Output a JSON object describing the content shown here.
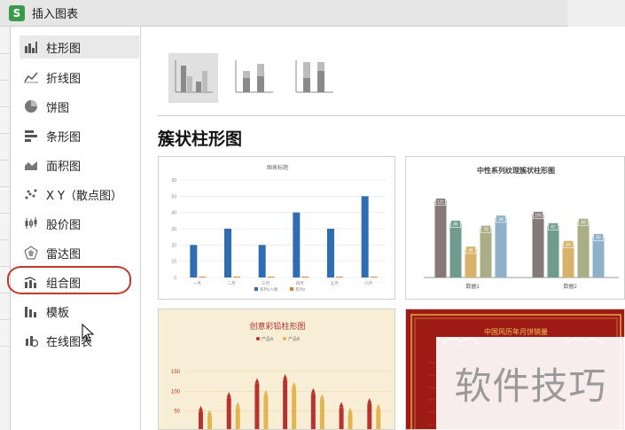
{
  "window": {
    "title": "插入图表",
    "logo_letter": "S"
  },
  "sidebar": {
    "items": [
      {
        "label": "柱形图",
        "icon": "column-chart-icon",
        "active": true
      },
      {
        "label": "折线图",
        "icon": "line-chart-icon"
      },
      {
        "label": "饼图",
        "icon": "pie-chart-icon"
      },
      {
        "label": "条形图",
        "icon": "bar-chart-icon"
      },
      {
        "label": "面积图",
        "icon": "area-chart-icon"
      },
      {
        "label": "X Y（散点图）",
        "icon": "scatter-chart-icon"
      },
      {
        "label": "股价图",
        "icon": "stock-chart-icon"
      },
      {
        "label": "雷达图",
        "icon": "radar-chart-icon"
      },
      {
        "label": "组合图",
        "icon": "combo-chart-icon"
      },
      {
        "label": "模板",
        "icon": "template-icon"
      },
      {
        "label": "在线图表",
        "icon": "online-chart-icon"
      }
    ]
  },
  "main": {
    "section_title": "簇状柱形图",
    "subtypes": [
      "clustered-column-icon",
      "stacked-column-icon",
      "percent-stacked-column-icon"
    ],
    "cards": [
      {
        "title": "图表标题",
        "chart_data": {
          "type": "bar",
          "title": "图表标题",
          "categories": [
            "一月",
            "二月",
            "三月",
            "四月",
            "五月",
            "六月"
          ],
          "series": [
            {
              "name": "系列1人数",
              "values": [
                20,
                30,
                20,
                40,
                30,
                50
              ],
              "color": "#2e6db3"
            },
            {
              "name": "系列2",
              "values": [
                0.5,
                0.5,
                0.5,
                0.5,
                0.5,
                0.5
              ],
              "color": "#e07b2a"
            }
          ],
          "ylim": [
            0,
            60
          ],
          "yticks": [
            0,
            10,
            20,
            30,
            40,
            50,
            60
          ]
        }
      },
      {
        "title": "中性系列纹理簇状柱形图",
        "chart_data": {
          "type": "bar",
          "title": "中性系列纹理簇状柱形图",
          "categories": [
            "数据1",
            "数据2"
          ],
          "series": [
            {
              "values": [
                121,
                100
              ],
              "color": "#857a78"
            },
            {
              "values": [
                86,
                82
              ],
              "color": "#6f9c8e"
            },
            {
              "values": [
                45,
                54
              ],
              "color": "#d8b26a"
            },
            {
              "values": [
                78,
                89
              ],
              "color": "#a9ae86"
            },
            {
              "values": [
                94,
                65
              ],
              "color": "#8eb0c8"
            }
          ],
          "ylim": [
            0,
            140
          ]
        }
      },
      {
        "title": "创意彩铅柱形图",
        "legend": [
          "产品A",
          "产品B"
        ],
        "chart_data": {
          "type": "bar",
          "title": "创意彩铅柱形图",
          "yticks": [
            0,
            50,
            100,
            150
          ],
          "ylim": [
            0,
            150
          ],
          "series": [
            {
              "name": "产品A",
              "values": [
                50,
                85,
                120,
                130,
                95,
                60,
                70
              ],
              "color": "#b8322e"
            },
            {
              "name": "产品B",
              "values": [
                40,
                60,
                90,
                110,
                80,
                45,
                55
              ],
              "color": "#e3b54e"
            }
          ]
        }
      },
      {
        "title": "中国风历年月饼销量",
        "chart_data": {
          "type": "bar",
          "title": "中国风历年月饼销量"
        }
      }
    ]
  },
  "watermark": "软件技巧"
}
